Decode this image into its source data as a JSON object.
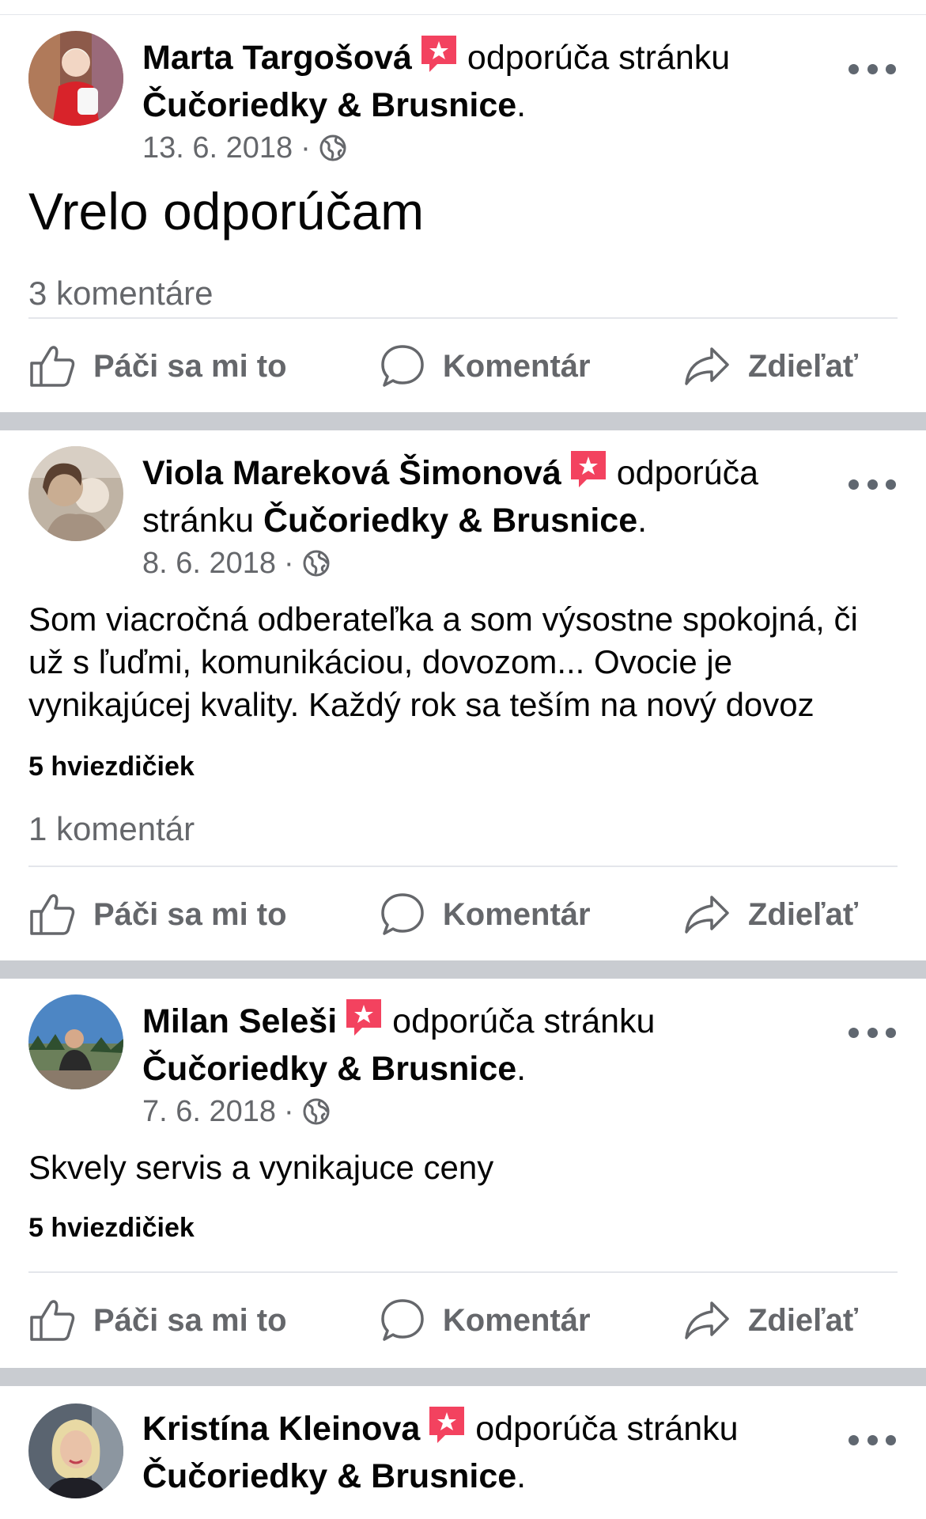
{
  "colors": {
    "text_primary": "#050505",
    "text_secondary": "#65676b",
    "badge_red": "#f3425f",
    "separator": "#c9ccd1",
    "divider": "#e4e6eb"
  },
  "labels": {
    "recommends_connector": "odporúča stránku",
    "like": "Páči sa mi to",
    "comment": "Komentár",
    "share": "Zdieľať",
    "meta_separator": "·"
  },
  "icons": {
    "badge": "recommendation-star-icon",
    "more": "more-options-icon",
    "privacy": "globe-icon",
    "like": "thumbs-up-icon",
    "comment": "comment-bubble-icon",
    "share": "share-arrow-icon"
  },
  "posts": [
    {
      "author": "Marta Targošová",
      "verb": "odporúča stránku",
      "page": "Čučoriedky & Brusnice",
      "page_suffix": ".",
      "date": "13. 6. 2018",
      "text": "Vrelo odporúčam",
      "comments": "3 komentáre"
    },
    {
      "author": "Viola Mareková Šimonová",
      "verb": "odporúča stránku",
      "page": "Čučoriedky & Brusnice",
      "page_suffix": ".",
      "date": "8. 6. 2018",
      "text": "Som viacročná odberateľka a som výsostne spokojná, či už s ľuďmi, komunikáciou, dovozom... Ovocie je vynikajúcej kvality. Každý rok sa teším na nový dovoz",
      "rating": "5 hviezdičiek",
      "comments": "1 komentár"
    },
    {
      "author": "Milan Seleši",
      "verb": "odporúča stránku",
      "page": "Čučoriedky & Brusnice",
      "page_suffix": ".",
      "date": "7. 6. 2018",
      "text": "Skvely servis a vynikajuce ceny",
      "rating": "5 hviezdičiek"
    },
    {
      "author": "Kristína Kleinova",
      "verb": "odporúča stránku",
      "page": "Čučoriedky & Brusnice",
      "page_suffix": "."
    }
  ]
}
